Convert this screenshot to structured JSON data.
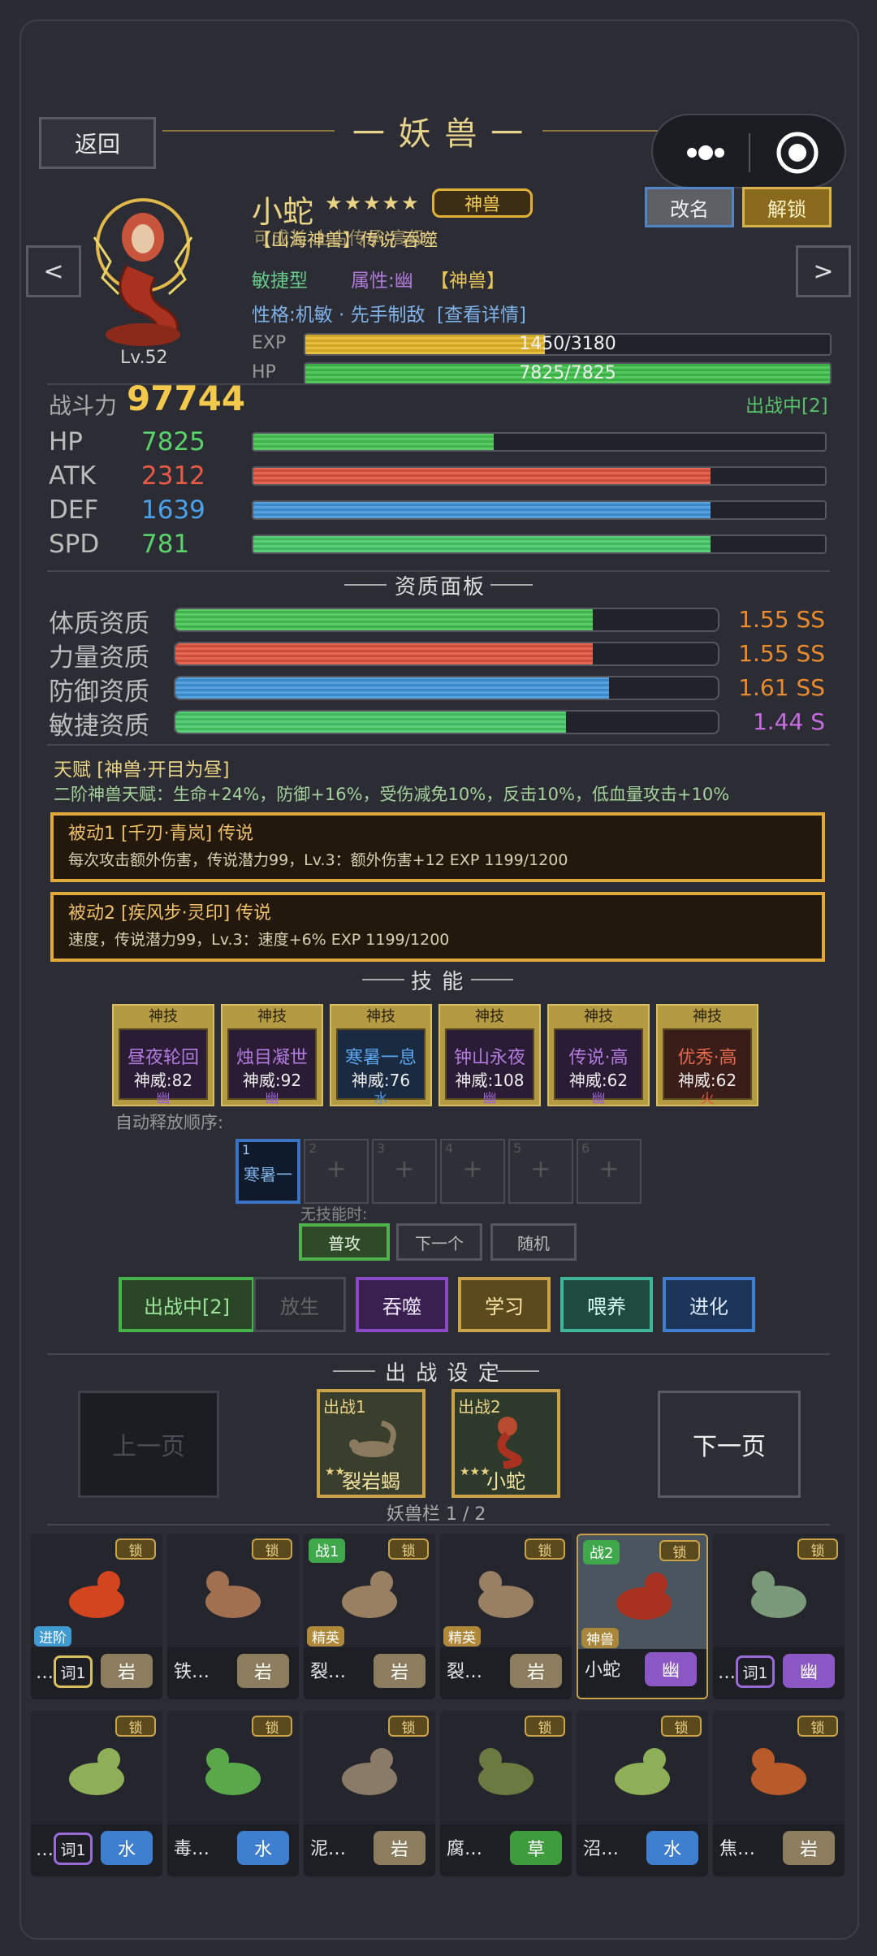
{
  "header": {
    "back": "返回",
    "title": "一 妖 兽 一"
  },
  "pet": {
    "name": "小蛇",
    "stars": "★★★★★",
    "rank_badge": "神兽",
    "overlap_line1": "【山海神兽】传说 吞噬",
    "overlap_line2": "可成长 上古传承 高级",
    "type": "敏捷型",
    "attr": "属性:幽",
    "tag": "【神兽】",
    "personality": "性格:机敏 · 先手制敌",
    "detail_link": "[查看详情]",
    "level": "Lv.52",
    "exp_label": "EXP",
    "exp_text": "1450/3180",
    "exp": 0.456,
    "hp_label": "HP",
    "hp_text": "7825/7825",
    "hp": 1.0
  },
  "buttons": {
    "rename": "改名",
    "unlock": "解锁",
    "prev": "<",
    "next": ">"
  },
  "power": {
    "label": "战斗力",
    "value": "97744",
    "status": "出战中[2]"
  },
  "stats": [
    {
      "name": "HP",
      "value": "7825",
      "fill": 0.42,
      "color": "#44c24f",
      "vcolor": "#59d36a"
    },
    {
      "name": "ATK",
      "value": "2312",
      "fill": 0.8,
      "color": "#e0523f",
      "vcolor": "#ea5b47"
    },
    {
      "name": "DEF",
      "value": "1639",
      "fill": 0.8,
      "color": "#3f94d9",
      "vcolor": "#4aa3ea"
    },
    {
      "name": "SPD",
      "value": "781",
      "fill": 0.8,
      "color": "#45c767",
      "vcolor": "#59d36a"
    }
  ],
  "aptitude": {
    "title": "资质面板",
    "rows": [
      {
        "name": "体质资质",
        "value": "1.55 SS",
        "fill": 0.77,
        "color": "#44c24f",
        "vcolor": "#e98b2e"
      },
      {
        "name": "力量资质",
        "value": "1.55 SS",
        "fill": 0.77,
        "color": "#e0523f",
        "vcolor": "#e98b2e"
      },
      {
        "name": "防御资质",
        "value": "1.61 SS",
        "fill": 0.8,
        "color": "#3f94d9",
        "vcolor": "#e98b2e"
      },
      {
        "name": "敏捷资质",
        "value": "1.44 S",
        "fill": 0.72,
        "color": "#45c767",
        "vcolor": "#c56ddf"
      }
    ]
  },
  "talent": {
    "title": "天赋 [神兽·开目为昼]",
    "desc": "二阶神兽天赋：生命+24%，防御+16%，受伤减免10%，反击10%，低血量攻击+10%"
  },
  "passives": [
    {
      "title": "被动1 [千刃·青岚] 传说",
      "desc": "每次攻击额外伤害，传说潜力99，Lv.3：额外伤害+12  EXP 1199/1200"
    },
    {
      "title": "被动2 [疾风步·灵印] 传说",
      "desc": "速度，传说潜力99，Lv.3：速度+6%  EXP 1199/1200"
    }
  ],
  "skills": {
    "title": "技 能",
    "items": [
      {
        "head": "神技",
        "name": "昼夜轮回",
        "power": "神威:82",
        "elem": "幽",
        "ncolor": "#b47be0",
        "bg": "#2a1c35",
        "ecolor": "#9a63cf"
      },
      {
        "head": "神技",
        "name": "烛目凝世",
        "power": "神威:92",
        "elem": "幽",
        "ncolor": "#b47be0",
        "bg": "#2a1c35",
        "ecolor": "#9a63cf"
      },
      {
        "head": "神技",
        "name": "寒暑一息",
        "power": "神威:76",
        "elem": "水",
        "ncolor": "#5ba6ef",
        "bg": "#1a2a40",
        "ecolor": "#4c93e0"
      },
      {
        "head": "神技",
        "name": "钟山永夜",
        "power": "神威:108",
        "elem": "幽",
        "ncolor": "#b47be0",
        "bg": "#2a1c35",
        "ecolor": "#9a63cf"
      },
      {
        "head": "神技",
        "name": "传说·高",
        "power": "神威:62",
        "elem": "幽",
        "ncolor": "#b47be0",
        "bg": "#2a1c35",
        "ecolor": "#9a63cf"
      },
      {
        "head": "神技",
        "name": "优秀·高",
        "power": "神威:62",
        "elem": "火",
        "ncolor": "#e56b4e",
        "bg": "#3a1c18",
        "ecolor": "#e0523f"
      }
    ],
    "order_label": "自动释放顺序:",
    "slots": [
      {
        "num": "1",
        "text": "寒暑一"
      },
      {
        "num": "2",
        "text": "+"
      },
      {
        "num": "3",
        "text": "+"
      },
      {
        "num": "4",
        "text": "+"
      },
      {
        "num": "5",
        "text": "+"
      },
      {
        "num": "6",
        "text": "+"
      }
    ],
    "no_skill_label": "无技能时:",
    "modes": [
      "普攻",
      "下一个",
      "随机"
    ]
  },
  "actions": [
    "出战中[2]",
    "放生",
    "吞噬",
    "学习",
    "喂养",
    "进化"
  ],
  "battle": {
    "title": "出 战 设 定",
    "prev_page": "上一页",
    "next_page": "下一页",
    "slots": [
      {
        "tag": "出战1",
        "name": "裂岩蝎",
        "stars": "★★"
      },
      {
        "tag": "出战2",
        "name": "小蛇",
        "stars": "★★★"
      }
    ],
    "page_info": "妖兽栏 1 / 2"
  },
  "roster": [
    {
      "lock": "锁",
      "name": "…",
      "elem": "岩",
      "sub": "进阶",
      "word": "词1",
      "battle": ""
    },
    {
      "lock": "锁",
      "name": "铁…",
      "elem": "岩",
      "sub": "",
      "word": "",
      "battle": ""
    },
    {
      "lock": "锁",
      "name": "裂…",
      "elem": "岩",
      "sub": "精英",
      "word": "",
      "battle": "战1"
    },
    {
      "lock": "锁",
      "name": "裂…",
      "elem": "岩",
      "sub": "精英",
      "word": "",
      "battle": ""
    },
    {
      "lock": "锁",
      "name": "小蛇",
      "elem": "幽",
      "sub": "神兽",
      "word": "",
      "battle": "战2"
    },
    {
      "lock": "锁",
      "name": "…",
      "elem": "幽",
      "sub": "",
      "word": "词1",
      "battle": ""
    },
    {
      "lock": "锁",
      "name": "…",
      "elem": "水",
      "sub": "",
      "word": "词1",
      "battle": ""
    },
    {
      "lock": "锁",
      "name": "毒…",
      "elem": "水",
      "sub": "",
      "word": "",
      "battle": ""
    },
    {
      "lock": "锁",
      "name": "泥…",
      "elem": "岩",
      "sub": "",
      "word": "",
      "battle": ""
    },
    {
      "lock": "锁",
      "name": "腐…",
      "elem": "草",
      "sub": "",
      "word": "",
      "battle": ""
    },
    {
      "lock": "锁",
      "name": "沼…",
      "elem": "水",
      "sub": "",
      "word": "",
      "battle": ""
    },
    {
      "lock": "锁",
      "name": "焦…",
      "elem": "岩",
      "sub": "",
      "word": "",
      "battle": ""
    }
  ],
  "element_colors": {
    "岩": "#8c7d5e",
    "幽": "#8a57c4",
    "水": "#3e7fd0",
    "草": "#3e9c3e"
  }
}
